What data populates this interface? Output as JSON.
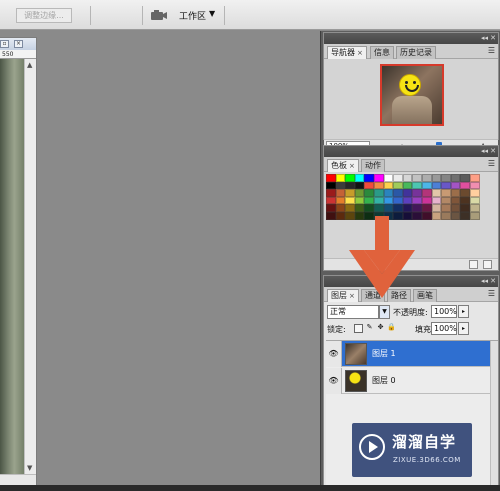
{
  "options_bar": {
    "refine_edge_label": "调整边缘...",
    "workspace_label": "工作区"
  },
  "document": {
    "ruler_value": "550"
  },
  "panels": {
    "navigator": {
      "tabs": [
        "导航器",
        "信息",
        "历史记录"
      ],
      "zoom": "100%"
    },
    "swatches": {
      "tabs": [
        "色板",
        "动作"
      ],
      "colors": [
        "#ff0000",
        "#ffff00",
        "#00ff00",
        "#00ffff",
        "#0000ff",
        "#ff00ff",
        "#ffffff",
        "#ebebeb",
        "#d6d6d6",
        "#c2c2c2",
        "#adadad",
        "#999999",
        "#858585",
        "#707070",
        "#5c5c5c",
        "#ff9f86",
        "#000000",
        "#3b3b3b",
        "#262626",
        "#121212",
        "#f24b3c",
        "#f58a44",
        "#fbd34d",
        "#a0cc5a",
        "#48b95b",
        "#4cc6b1",
        "#4cb6e8",
        "#4c7fd6",
        "#6957c7",
        "#a354c4",
        "#e04f9f",
        "#f08eb0",
        "#9b1b1b",
        "#c56236",
        "#c79d2a",
        "#6d9a32",
        "#2a8a3c",
        "#2a9b88",
        "#2a84bd",
        "#2a58a6",
        "#41339b",
        "#77339a",
        "#b33479",
        "#e3c7a9",
        "#c89a73",
        "#9c6e4a",
        "#6b4a2e",
        "#ffcf9f",
        "#cc3333",
        "#e57e2a",
        "#ffe14d",
        "#8fcc3d",
        "#33b34d",
        "#33b3a6",
        "#3399e6",
        "#3366cc",
        "#5c40bf",
        "#9940bf",
        "#cc3399",
        "#e6b3cc",
        "#b38866",
        "#80563a",
        "#4d3320",
        "#d9d9a6",
        "#661111",
        "#8c4417",
        "#8c6b12",
        "#3d5c16",
        "#134d1f",
        "#135c52",
        "#134d73",
        "#132e63",
        "#231759",
        "#431759",
        "#661743",
        "#d4b5a0",
        "#a67a5a",
        "#73513a",
        "#402c1f",
        "#bfb38c",
        "#401010",
        "#5c2a0d",
        "#5c450d",
        "#26390d",
        "#0d2e13",
        "#0d3a33",
        "#0d2e47",
        "#0d1c3d",
        "#160e38",
        "#2a0e38",
        "#400e2a",
        "#c9a27f",
        "#9a7a5c",
        "#6b5542",
        "#3d3026",
        "#a89c7a"
      ]
    },
    "layers": {
      "tabs": [
        "图层",
        "通道",
        "路径",
        "画笔"
      ],
      "blend_mode": "正常",
      "opacity_label": "不透明度:",
      "opacity": "100%",
      "lock_label": "锁定:",
      "fill_label": "填充:",
      "fill": "100%",
      "items": [
        {
          "name": "图层 1",
          "selected": true
        },
        {
          "name": "图层 0",
          "selected": false
        }
      ]
    }
  },
  "watermark": {
    "brand": "溜溜自学",
    "url": "ZIXUE.3D66.COM"
  },
  "colors": {
    "selection_blue": "#2f6fd0",
    "arrow_orange": "#e0623c"
  }
}
